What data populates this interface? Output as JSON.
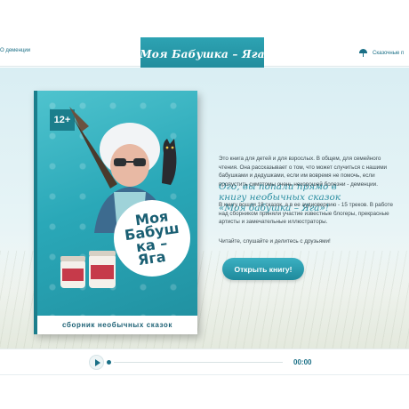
{
  "header": {
    "left_link": "О деменции",
    "right_link": "Сказочные п",
    "logo_text": "Моя Бабушка – Яга"
  },
  "book": {
    "age_badge": "12+",
    "cover_title": [
      "Моя",
      "Бабуш",
      "ка –",
      "Яга"
    ],
    "cover_subtitle": "сборник необычных сказок"
  },
  "intro": {
    "headline": [
      "Ого, вы попали прямо в",
      "книгу необычных сказок",
      "«Моя бабушка – Яга»!"
    ],
    "paragraph1": "Это книга для детей и для взрослых. В общем, для семейного чтения. Она рассказывает о том, что может случиться с нашими бабушками и дедушками, если им вовремя не помочь, если пропустить симптомы очень нехорошей болезни - деменции.",
    "paragraph2": "В книгу вошли 18 сказок, а в ее аудиоверсию - 15 треков. В работе над сборником приняли участие известные блогеры, прекрасные артисты и замечательные иллюстраторы.",
    "paragraph3": "Читайте, слушайте и делитесь с друзьями!",
    "open_button": "Открыть книгу!"
  },
  "player": {
    "time": "00:00",
    "progress": 0
  },
  "colors": {
    "accent": "#2d8fa2",
    "ribbon": "#1f8797",
    "link": "#1a6f86"
  }
}
